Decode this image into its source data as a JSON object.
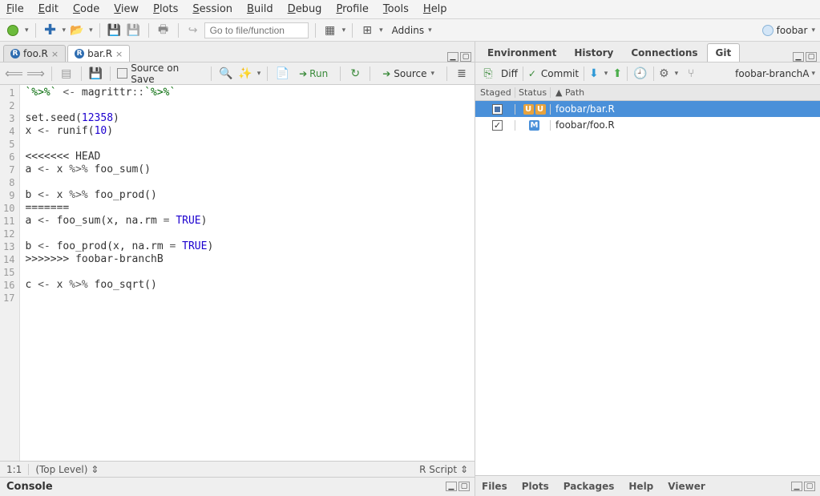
{
  "menubar": [
    "File",
    "Edit",
    "Code",
    "View",
    "Plots",
    "Session",
    "Build",
    "Debug",
    "Profile",
    "Tools",
    "Help"
  ],
  "topbar": {
    "gotofile_placeholder": "Go to file/function",
    "addins": "Addins",
    "project": "foobar"
  },
  "editor": {
    "tabs": [
      {
        "label": "foo.R",
        "active": false
      },
      {
        "label": "bar.R",
        "active": true
      }
    ],
    "source_on_save": "Source on Save",
    "run": "Run",
    "source_btn": "Source",
    "cursor": "1:1",
    "scope": "(Top Level)",
    "lang": "R Script",
    "lines": [
      {
        "n": 1,
        "html": "<span class='s-str'>`%>%`</span> <span class='s-op'>&lt;-</span> magrittr<span class='s-op'>::</span><span class='s-str'>`%>%`</span>"
      },
      {
        "n": 2,
        "html": ""
      },
      {
        "n": 3,
        "html": "set.seed(<span class='s-num'>12358</span>)"
      },
      {
        "n": 4,
        "html": "x <span class='s-op'>&lt;-</span> runif(<span class='s-num'>10</span>)"
      },
      {
        "n": 5,
        "html": ""
      },
      {
        "n": 6,
        "html": "&lt;&lt;&lt;&lt;&lt;&lt;&lt; HEAD"
      },
      {
        "n": 7,
        "html": "a <span class='s-op'>&lt;-</span> x <span class='s-op'>%&gt;%</span> foo_sum()"
      },
      {
        "n": 8,
        "html": ""
      },
      {
        "n": 9,
        "html": "b <span class='s-op'>&lt;-</span> x <span class='s-op'>%&gt;%</span> foo_prod()"
      },
      {
        "n": 10,
        "html": "======="
      },
      {
        "n": 11,
        "html": "a <span class='s-op'>&lt;-</span> foo_sum(x, na.rm <span class='s-op'>=</span> <span class='s-bool'>TRUE</span>)"
      },
      {
        "n": 12,
        "html": ""
      },
      {
        "n": 13,
        "html": "b <span class='s-op'>&lt;-</span> foo_prod(x, na.rm <span class='s-op'>=</span> <span class='s-bool'>TRUE</span>)"
      },
      {
        "n": 14,
        "html": "&gt;&gt;&gt;&gt;&gt;&gt;&gt; foobar-branchB"
      },
      {
        "n": 15,
        "html": ""
      },
      {
        "n": 16,
        "html": "c <span class='s-op'>&lt;-</span> x <span class='s-op'>%&gt;%</span> foo_sqrt()"
      },
      {
        "n": 17,
        "html": ""
      }
    ]
  },
  "console": {
    "title": "Console"
  },
  "right_tabs_top": [
    "Environment",
    "History",
    "Connections",
    "Git"
  ],
  "right_tabs_bottom": [
    "Files",
    "Plots",
    "Packages",
    "Help",
    "Viewer"
  ],
  "git": {
    "diff": "Diff",
    "commit": "Commit",
    "branch": "foobar-branchA",
    "cols": {
      "staged": "Staged",
      "status": "Status",
      "path": "Path"
    },
    "rows": [
      {
        "staged": "square",
        "status": [
          "U",
          "U"
        ],
        "path": "foobar/bar.R",
        "selected": true
      },
      {
        "staged": "check",
        "status": [
          "M"
        ],
        "path": "foobar/foo.R",
        "selected": false
      }
    ]
  }
}
